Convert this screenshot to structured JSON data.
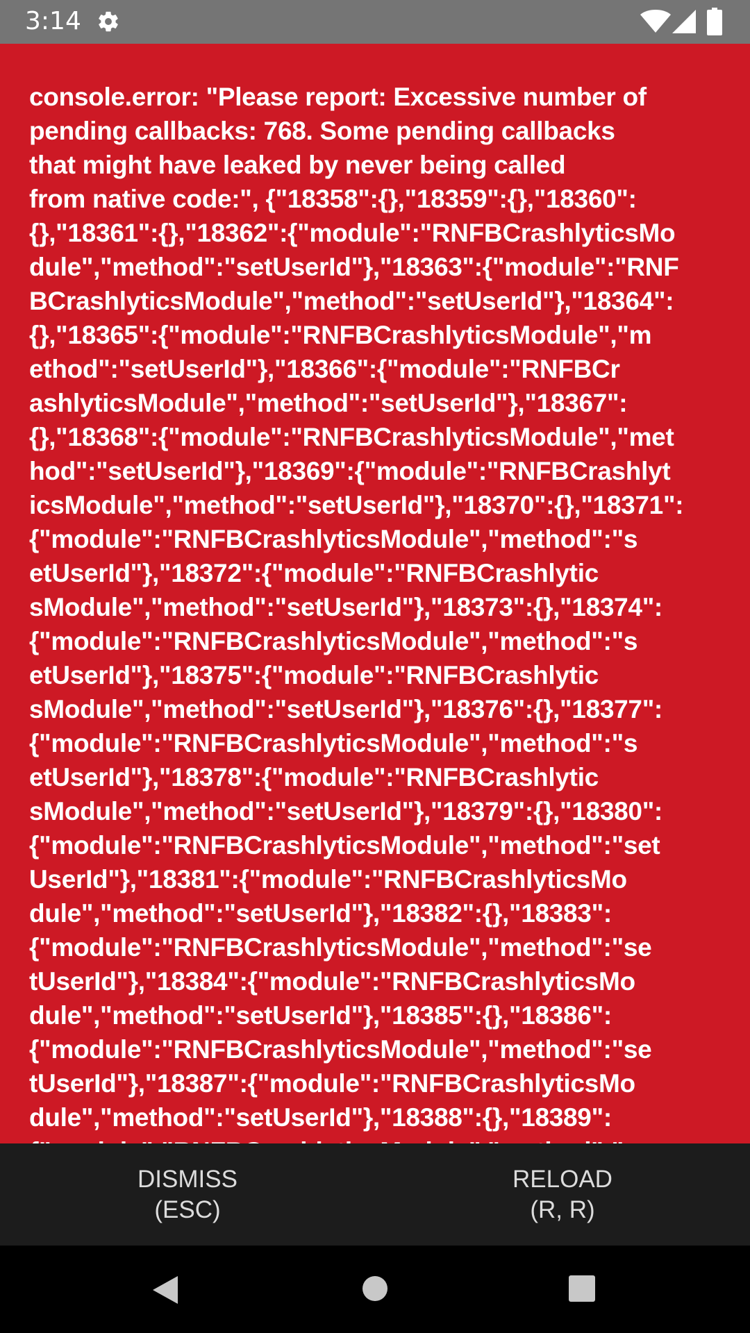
{
  "status_bar": {
    "time": "3:14",
    "icons": [
      "gear-icon",
      "wifi-icon",
      "signal-icon",
      "battery-icon"
    ]
  },
  "error": {
    "background_color": "#cd1925",
    "lines": [
      "console.error: \"Please report: Excessive number of",
      "pending callbacks: 768. Some pending callbacks",
      "that might have leaked by never being called",
      "from native code:\", {\"18358\":{},\"18359\":{},\"18360\":",
      "{},\"18361\":{},\"18362\":{\"module\":\"RNFBCrashlyticsMo",
      "dule\",\"method\":\"setUserId\"},\"18363\":{\"module\":\"RNF",
      "BCrashlyticsModule\",\"method\":\"setUserId\"},\"18364\":",
      "{},\"18365\":{\"module\":\"RNFBCrashlyticsModule\",\"m",
      "ethod\":\"setUserId\"},\"18366\":{\"module\":\"RNFBCr",
      "ashlyticsModule\",\"method\":\"setUserId\"},\"18367\":",
      "{},\"18368\":{\"module\":\"RNFBCrashlyticsModule\",\"met",
      "hod\":\"setUserId\"},\"18369\":{\"module\":\"RNFBCrashlyt",
      "icsModule\",\"method\":\"setUserId\"},\"18370\":{},\"18371\":",
      "{\"module\":\"RNFBCrashlyticsModule\",\"method\":\"s",
      "etUserId\"},\"18372\":{\"module\":\"RNFBCrashlytic",
      "sModule\",\"method\":\"setUserId\"},\"18373\":{},\"18374\":",
      "{\"module\":\"RNFBCrashlyticsModule\",\"method\":\"s",
      "etUserId\"},\"18375\":{\"module\":\"RNFBCrashlytic",
      "sModule\",\"method\":\"setUserId\"},\"18376\":{},\"18377\":",
      "{\"module\":\"RNFBCrashlyticsModule\",\"method\":\"s",
      "etUserId\"},\"18378\":{\"module\":\"RNFBCrashlytic",
      "sModule\",\"method\":\"setUserId\"},\"18379\":{},\"18380\":",
      "{\"module\":\"RNFBCrashlyticsModule\",\"method\":\"set",
      "UserId\"},\"18381\":{\"module\":\"RNFBCrashlyticsMo",
      "dule\",\"method\":\"setUserId\"},\"18382\":{},\"18383\":",
      "{\"module\":\"RNFBCrashlyticsModule\",\"method\":\"se",
      "tUserId\"},\"18384\":{\"module\":\"RNFBCrashlyticsMo",
      "dule\",\"method\":\"setUserId\"},\"18385\":{},\"18386\":",
      "{\"module\":\"RNFBCrashlyticsModule\",\"method\":\"se",
      "tUserId\"},\"18387\":{\"module\":\"RNFBCrashlyticsMo",
      "dule\",\"method\":\"setUserId\"},\"18388\":{},\"18389\":",
      "{\"module\":\"RNFBCrashlyticsModule\",\"method\":\"s"
    ]
  },
  "buttons": {
    "dismiss_line1": "DISMISS",
    "dismiss_line2": "(ESC)",
    "reload_line1": "RELOAD",
    "reload_line2": "(R, R)"
  },
  "nav_bar": {
    "icons": [
      "nav-back-icon",
      "nav-home-icon",
      "nav-recents-icon"
    ]
  }
}
